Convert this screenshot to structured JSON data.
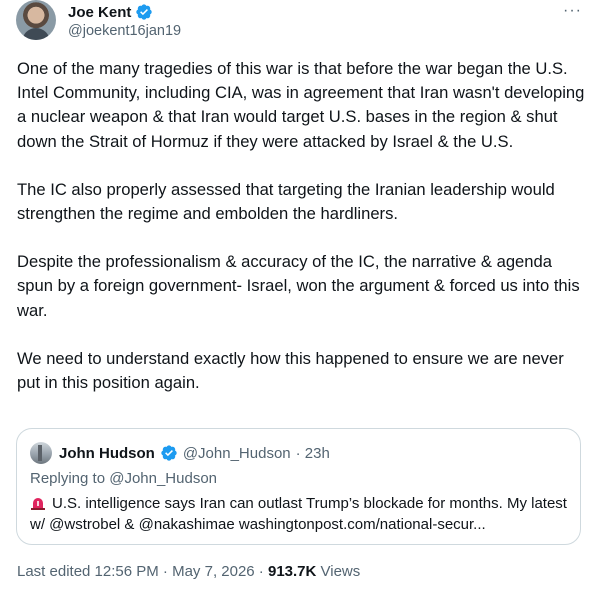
{
  "author": {
    "name": "Joe Kent",
    "handle": "@joekent16jan19",
    "verified": true
  },
  "tweet": {
    "paragraphs": [
      "One of the many tragedies of this war is that before the war began the U.S. Intel Community, including CIA, was in agreement that Iran wasn't developing a nuclear weapon & that Iran would target U.S. bases in the region & shut down the Strait of Hormuz if they were attacked by Israel & the U.S.",
      "The IC also properly assessed that targeting the Iranian leadership would strengthen the regime and embolden the hardliners.",
      "Despite the professionalism & accuracy of the IC, the narrative & agenda spun by a foreign government- Israel, won the argument & forced us into this war.",
      "We need to understand exactly how this happened to ensure we are never put in this position again."
    ]
  },
  "quoted": {
    "name": "John Hudson",
    "handle": "@John_Hudson",
    "time": "· 23h",
    "replying_to": "Replying to @John_Hudson",
    "icon": "siren-icon",
    "text": "U.S. intelligence says Iran can outlast Trump’s blockade for months. My latest w/ @wstrobel & @nakashimae washingtonpost.com/national-secur..."
  },
  "meta": {
    "edited": "Last edited 12:56 PM · May 7, 2026 · ",
    "views_count": "913.7K",
    "views_label": " Views"
  },
  "colors": {
    "verified_blue": "#1d9bf0",
    "secondary_text": "#536471",
    "border": "#cfd9de",
    "siren_red": "#e0245e"
  }
}
